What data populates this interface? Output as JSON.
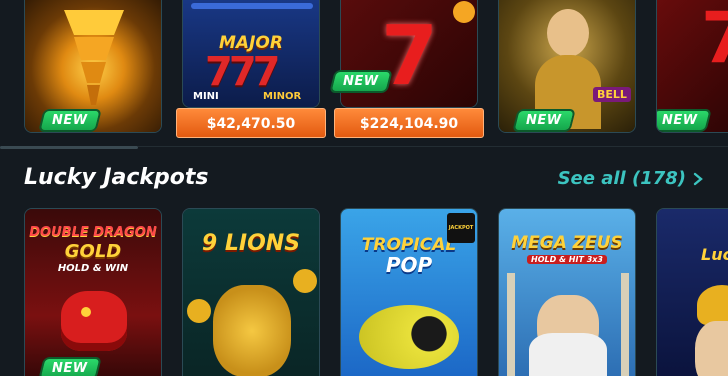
{
  "top_row": {
    "badge_new": "NEW",
    "card2": {
      "title": "MAJOR",
      "mini": "MINI",
      "minor": "MINOR",
      "jackpot": "$42,470.50"
    },
    "card3": {
      "jackpot": "$224,104.90",
      "badge": "NEW"
    },
    "card4": {
      "badge": "NEW",
      "logo": "BELL"
    },
    "card5": {
      "badge": "NEW"
    }
  },
  "section": {
    "title": "Lucky Jackpots",
    "see_all": "See all (178)"
  },
  "bottom_row": {
    "card1": {
      "title_line1": "DOUBLE DRAGON",
      "title_line2": "GOLD",
      "subtitle": "HOLD & WIN",
      "badge": "NEW"
    },
    "card2": {
      "title": "9 LIONS"
    },
    "card3": {
      "title_line1": "TROPICAL",
      "title_line2": "POP",
      "corner": "JACKPOT"
    },
    "card4": {
      "title": "MEGA ZEUS",
      "subtitle": "HOLD & HIT 3x3"
    },
    "card5": {
      "title": "Lucky"
    }
  },
  "colors": {
    "background": "#141a20",
    "accent_teal": "#3cc4c0",
    "new_green": "#22c55e",
    "jackpot_orange": "#f06a1c"
  }
}
